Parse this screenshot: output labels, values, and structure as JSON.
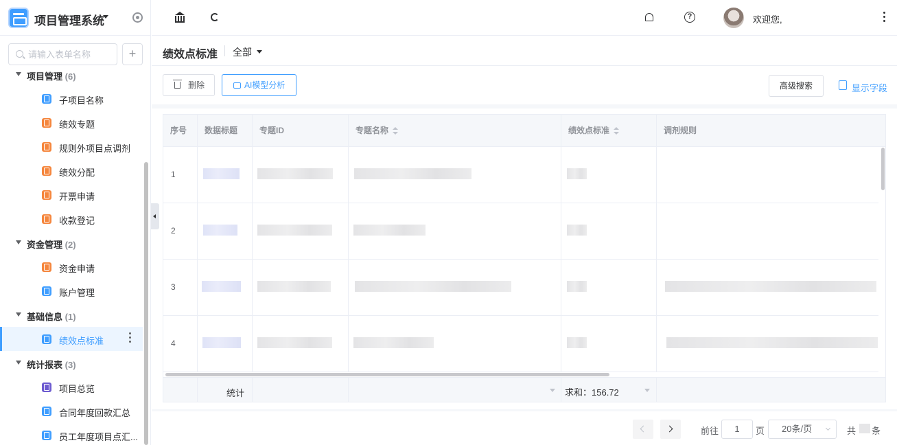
{
  "sidebar": {
    "app_title": "项目管理系统",
    "search_placeholder": "请输入表单名称",
    "add_label": "+",
    "groups": [
      {
        "label": "项目管理",
        "count": "(6)"
      },
      {
        "label": "资金管理",
        "count": "(2)"
      },
      {
        "label": "基础信息",
        "count": "(1)"
      },
      {
        "label": "统计报表",
        "count": "(3)"
      }
    ],
    "items": [
      {
        "label": "子项目名称",
        "icon": "form-icon",
        "color": "#409eff"
      },
      {
        "label": "绩效专题",
        "icon": "form-icon",
        "color": "#f5863d"
      },
      {
        "label": "规则外项目点调剂",
        "icon": "form-icon",
        "color": "#f5863d"
      },
      {
        "label": "绩效分配",
        "icon": "form-icon",
        "color": "#f5863d"
      },
      {
        "label": "开票申请",
        "icon": "form-icon",
        "color": "#f5863d"
      },
      {
        "label": "收款登记",
        "icon": "form-icon",
        "color": "#f5863d"
      },
      {
        "label": "资金申请",
        "icon": "form-icon",
        "color": "#f5863d"
      },
      {
        "label": "账户管理",
        "icon": "form-icon",
        "color": "#409eff"
      },
      {
        "label": "绩效点标准",
        "icon": "form-icon",
        "color": "#409eff"
      },
      {
        "label": "项目总览",
        "icon": "report-icon",
        "color": "#6d5bd0"
      },
      {
        "label": "合同年度回款汇总",
        "icon": "form-icon",
        "color": "#409eff"
      },
      {
        "label": "员工年度项目点汇...",
        "icon": "form-icon",
        "color": "#409eff"
      }
    ]
  },
  "topbar": {
    "welcome": "欢迎您,",
    "help_glyph": "?"
  },
  "page": {
    "title": "绩效点标准",
    "filter": "全部"
  },
  "toolbar": {
    "delete_label": "删除",
    "ai_label": "AI模型分析",
    "advanced_search_label": "高级搜索",
    "show_fields_label": "显示字段"
  },
  "table": {
    "columns": [
      "序号",
      "数据标题",
      "专题ID",
      "专题名称",
      "绩效点标准",
      "调剂规则"
    ],
    "rows": [
      {
        "index": "1"
      },
      {
        "index": "2"
      },
      {
        "index": "3"
      },
      {
        "index": "4"
      }
    ],
    "footer": {
      "stat_label": "统计",
      "sum_label": "求和：156.72"
    }
  },
  "pagination": {
    "goto_label": "前往",
    "page": "1",
    "page_unit": "页",
    "page_size": "20条/页",
    "total_prefix": "共",
    "total_suffix": "条"
  },
  "colors": {
    "accent": "#409eff",
    "orange": "#f5863d",
    "purple": "#6d5bd0"
  }
}
